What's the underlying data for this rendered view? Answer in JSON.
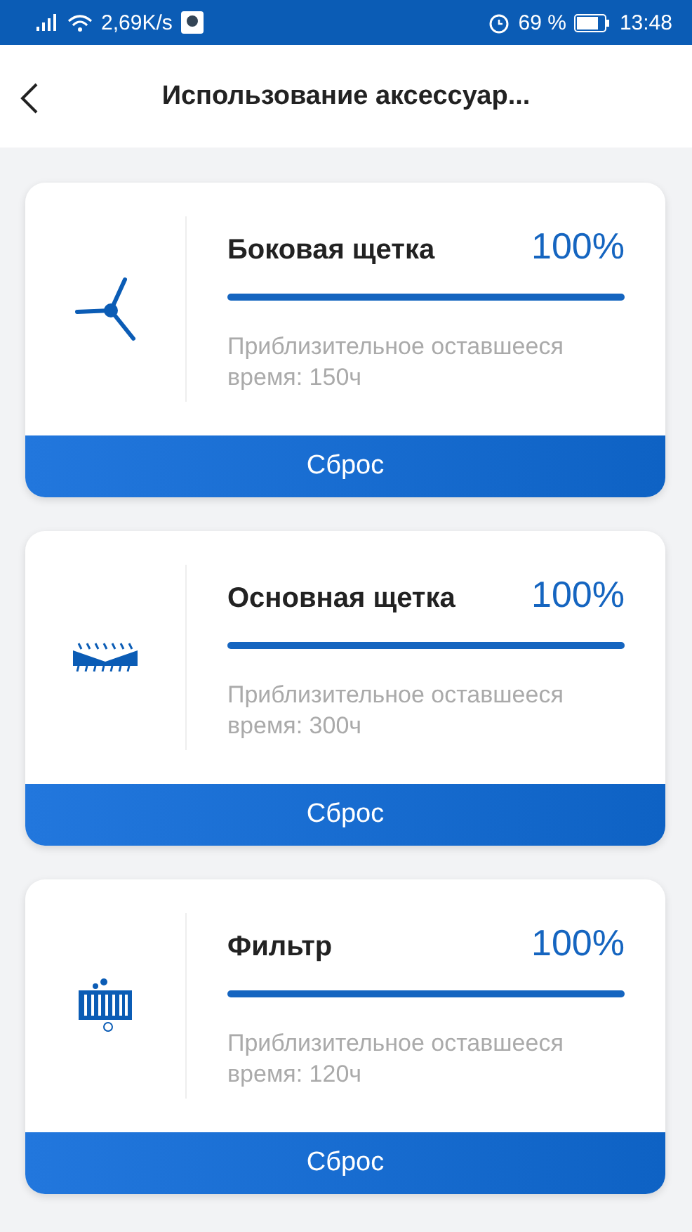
{
  "status_bar": {
    "speed": "2,69K/s",
    "battery": "69 %",
    "time": "13:48"
  },
  "header": {
    "title": "Использование аксессуар..."
  },
  "accessories": [
    {
      "kind": "side-brush",
      "name": "Боковая щетка",
      "percent": "100%",
      "level": 1,
      "remaining": "Приблизительное оставшееся время: 150ч",
      "button": "Сброс"
    },
    {
      "kind": "main-brush",
      "name": "Основная щетка",
      "percent": "100%",
      "level": 1,
      "remaining": "Приблизительное оставшееся время: 300ч",
      "button": "Сброс"
    },
    {
      "kind": "filter",
      "name": "Фильтр",
      "percent": "100%",
      "level": 1,
      "remaining": "Приблизительное оставшееся время: 120ч",
      "button": "Сброс"
    }
  ]
}
